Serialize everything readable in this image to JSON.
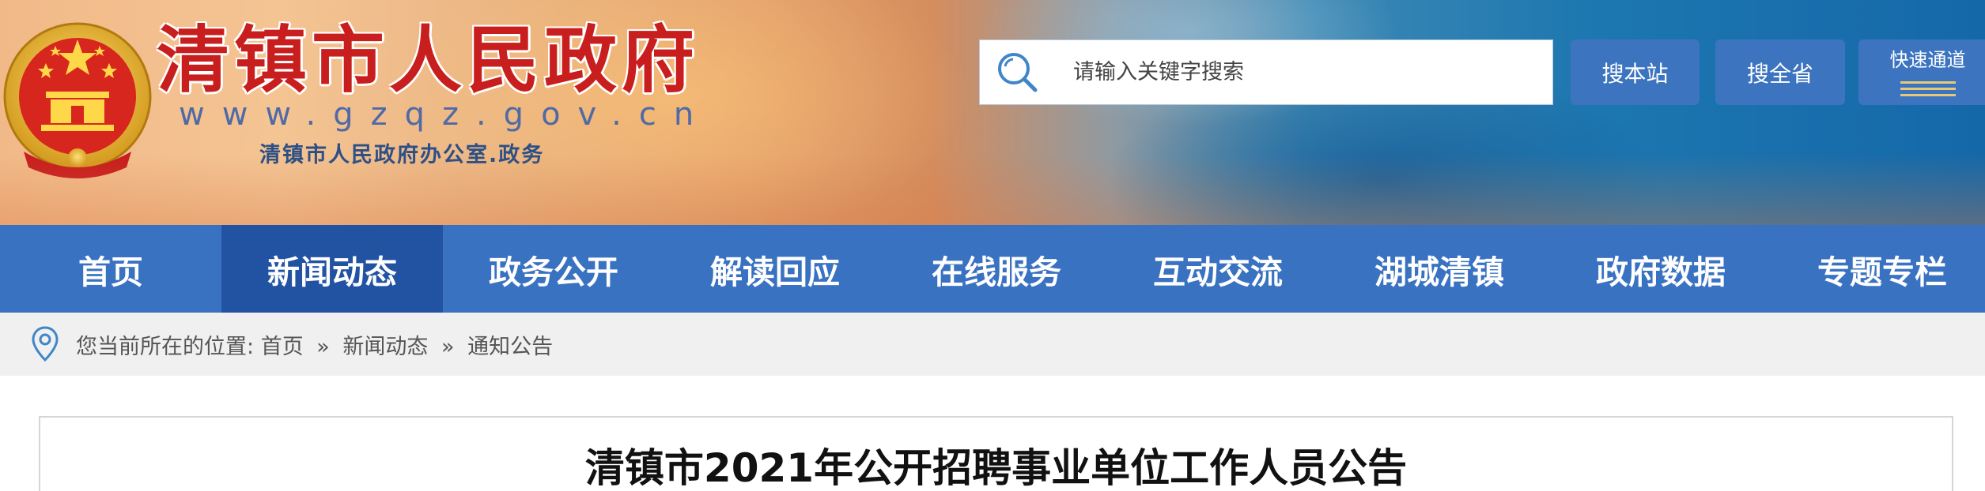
{
  "header": {
    "site_title": "清镇市人民政府",
    "site_url": "www.gzqz.gov.cn",
    "site_subtitle": "清镇市人民政府办公室.政务",
    "emblem_icon": "national-emblem-icon",
    "search": {
      "placeholder": "请输入关键字搜索",
      "value": "",
      "icon": "search-icon"
    },
    "buttons": {
      "search_site": "搜本站",
      "search_province": "搜全省",
      "quick_access": "快速通道"
    }
  },
  "nav": {
    "items": [
      {
        "label": "首页"
      },
      {
        "label": "新闻动态"
      },
      {
        "label": "政务公开"
      },
      {
        "label": "解读回应"
      },
      {
        "label": "在线服务"
      },
      {
        "label": "互动交流"
      },
      {
        "label": "湖城清镇"
      },
      {
        "label": "政府数据"
      },
      {
        "label": "专题专栏"
      }
    ],
    "active_index": 1
  },
  "breadcrumb": {
    "icon": "location-pin-icon",
    "prefix": "您当前所在的位置:",
    "items": [
      {
        "label": "首页"
      },
      {
        "label": "新闻动态"
      },
      {
        "label": "通知公告"
      }
    ],
    "separator": "»"
  },
  "article": {
    "title": "清镇市2021年公开招聘事业单位工作人员公告"
  },
  "colors": {
    "nav_bg": "#3a72c2",
    "nav_active_bg": "#2253a3",
    "button_bg": "#3c74c0",
    "title_red": "#c81e1e",
    "breadcrumb_bg": "#f0f0f0"
  }
}
